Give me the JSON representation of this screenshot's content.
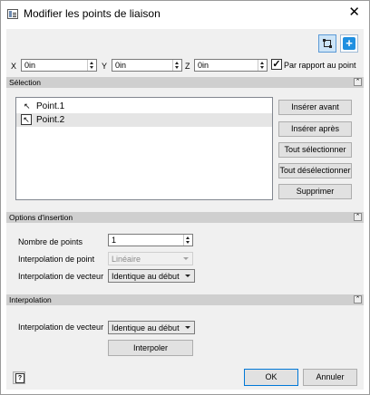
{
  "window": {
    "title": "Modifier les points de liaison"
  },
  "toolbar": {
    "select_icon": "select-points-icon",
    "add_icon": "add-point-icon"
  },
  "coords": {
    "x_label": "X",
    "x_value": "0in",
    "y_label": "Y",
    "y_value": "0in",
    "z_label": "Z",
    "z_value": "0in",
    "relative_checked": true,
    "relative_label": "Par rapport au point"
  },
  "selection": {
    "header": "Sélection",
    "points": [
      {
        "label": "Point.1",
        "selected": false
      },
      {
        "label": "Point.2",
        "selected": true
      }
    ],
    "buttons": {
      "insert_before": "Insérer avant",
      "insert_after": "Insérer après",
      "select_all": "Tout sélectionner",
      "deselect_all": "Tout désélectionner",
      "delete": "Supprimer"
    }
  },
  "insertion": {
    "header": "Options d'insertion",
    "num_points_label": "Nombre de points",
    "num_points_value": "1",
    "point_interp_label": "Interpolation de point",
    "point_interp_value": "Linéaire",
    "vector_interp_label": "Interpolation de vecteur",
    "vector_interp_value": "Identique au début"
  },
  "interpolation": {
    "header": "Interpolation",
    "vector_interp_label": "Interpolation de vecteur",
    "vector_interp_value": "Identique au début",
    "interpolate_button": "Interpoler"
  },
  "footer": {
    "ok": "OK",
    "cancel": "Annuler"
  },
  "colors": {
    "section_header": "#cfcfcf",
    "dialog_bg": "#f0f0f0",
    "accent": "#0078d7"
  }
}
